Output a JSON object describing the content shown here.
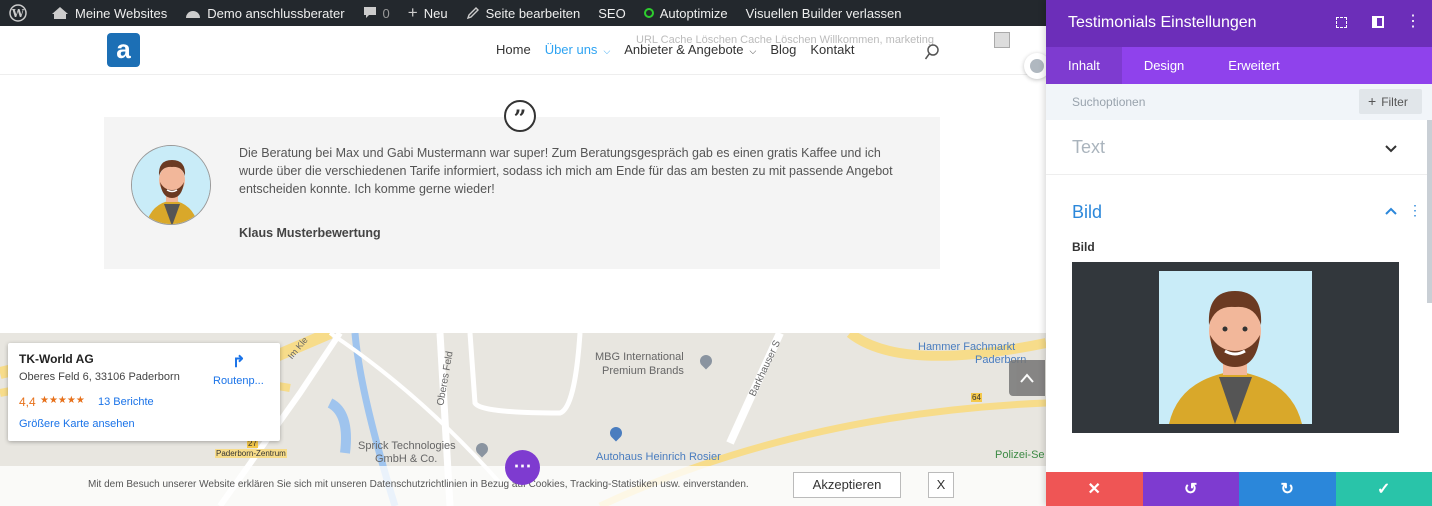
{
  "adminbar": {
    "sites": "Meine Websites",
    "site": "Demo anschlussberater",
    "comments": "0",
    "new": "Neu",
    "edit": "Seite bearbeiten",
    "seo": "SEO",
    "autoptimize": "Autoptimize",
    "exit": "Visuellen Builder verlassen"
  },
  "header": {
    "logo": "a",
    "nav": [
      "Home",
      "Über uns",
      "Anbieter & Angebote",
      "Blog",
      "Kontakt"
    ],
    "ghost": "URL Cache Löschen    Cache Löschen    Willkommen, marketing"
  },
  "testimonial": {
    "body": "Die Beratung bei Max und Gabi Mustermann war super! Zum Beratungsgespräch gab es einen gratis Kaffee und ich wurde über die verschiedenen Tarife informiert, sodass ich mich am Ende für das am besten zu mit passende Angebot entscheiden konnte. Ich komme gerne wieder!",
    "author": "Klaus Musterbewertung"
  },
  "map": {
    "name": "TK-World AG",
    "address": "Oberes Feld 6, 33106 Paderborn",
    "rating": "4,4",
    "stars": "★★★★★",
    "reviews": "13 Berichte",
    "bigger": "Größere Karte ansehen",
    "route": "Routenp...",
    "labels": [
      "MBG International",
      "Premium Brands",
      "Hammer Fachmarkt",
      "Paderborn",
      "Sprick Technologies",
      "GmbH & Co.",
      "Autohaus Heinrich Rosier",
      "Polizei-Se",
      "Oberes Feld",
      "Barkhauser S",
      "Im Kle",
      "Paderborn-Zentrum",
      "27",
      "64"
    ]
  },
  "cookie": {
    "text": "Mit dem Besuch unserer Website erklären Sie sich mit unseren Datenschutzrichtlinien in Bezug auf Cookies, Tracking-Statistiken usw. einverstanden.",
    "accept": "Akzeptieren",
    "close": "X"
  },
  "panel": {
    "title": "Testimonials Einstellungen",
    "tabs": [
      "Inhalt",
      "Design",
      "Erweitert"
    ],
    "search": "Suchoptionen",
    "filter": "Filter",
    "text_section": "Text",
    "bild_section": "Bild",
    "bild_label": "Bild"
  },
  "colors": {
    "panel_header": "#6c2eb9",
    "panel_tabs": "#8f42ec",
    "accent": "#2ea3f2",
    "cancel": "#ef5555",
    "undo": "#7e3bd0",
    "redo": "#2b87da",
    "save": "#29c4a9"
  }
}
